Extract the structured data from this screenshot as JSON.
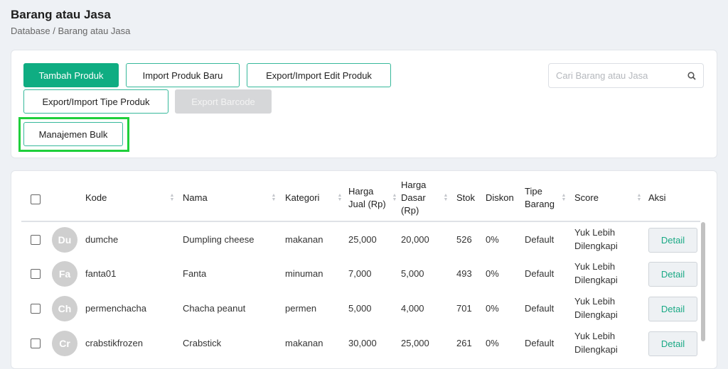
{
  "header": {
    "title": "Barang atau Jasa",
    "breadcrumb": "Database / Barang atau Jasa"
  },
  "toolbar": {
    "tambah": "Tambah Produk",
    "import_baru": "Import Produk Baru",
    "edit": "Export/Import Edit Produk",
    "tipe": "Export/Import Tipe Produk",
    "barcode": "Export Barcode",
    "bulk": "Manajemen Bulk",
    "search_placeholder": "Cari Barang atau Jasa"
  },
  "table": {
    "headers": {
      "kode": "Kode",
      "nama": "Nama",
      "kategori": "Kategori",
      "harga_jual": "Harga Jual (Rp)",
      "harga_dasar": "Harga Dasar (Rp)",
      "stok": "Stok",
      "diskon": "Diskon",
      "tipe": "Tipe Barang",
      "score": "Score",
      "aksi": "Aksi"
    },
    "rows": [
      {
        "initials": "Du",
        "kode": "dumche",
        "nama": "Dumpling cheese",
        "kategori": "makanan",
        "jual": "25,000",
        "dasar": "20,000",
        "stok": "526",
        "diskon": "0%",
        "tipe": "Default",
        "score": "Yuk Lebih Dilengkapi",
        "aksi": "Detail"
      },
      {
        "initials": "Fa",
        "kode": "fanta01",
        "nama": "Fanta",
        "kategori": "minuman",
        "jual": "7,000",
        "dasar": "5,000",
        "stok": "493",
        "diskon": "0%",
        "tipe": "Default",
        "score": "Yuk Lebih Dilengkapi",
        "aksi": "Detail"
      },
      {
        "initials": "Ch",
        "kode": "permenchacha",
        "nama": "Chacha peanut",
        "kategori": "permen",
        "jual": "5,000",
        "dasar": "4,000",
        "stok": "701",
        "diskon": "0%",
        "tipe": "Default",
        "score": "Yuk Lebih Dilengkapi",
        "aksi": "Detail"
      },
      {
        "initials": "Cr",
        "kode": "crabstikfrozen",
        "nama": "Crabstick",
        "kategori": "makanan",
        "jual": "30,000",
        "dasar": "25,000",
        "stok": "261",
        "diskon": "0%",
        "tipe": "Default",
        "score": "Yuk Lebih Dilengkapi",
        "aksi": "Detail"
      }
    ]
  }
}
